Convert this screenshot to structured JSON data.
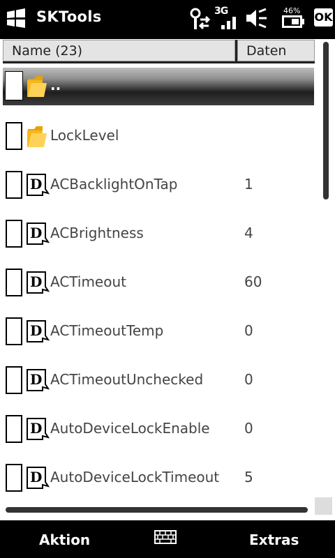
{
  "title_bar": {
    "app_title": "SKTools",
    "network_type": "3G",
    "battery_percent": "46%",
    "ok_label": "OK"
  },
  "list": {
    "columns": {
      "name": "Name (23)",
      "data": "Daten"
    },
    "rows": [
      {
        "name": "..",
        "value": "",
        "icon": "folder-icon",
        "selected": true
      },
      {
        "name": "LockLevel",
        "value": "",
        "icon": "folder-icon",
        "selected": false
      },
      {
        "name": "ACBacklightOnTap",
        "value": "1",
        "icon": "dword-value-icon",
        "selected": false
      },
      {
        "name": "ACBrightness",
        "value": "4",
        "icon": "dword-value-icon",
        "selected": false
      },
      {
        "name": "ACTimeout",
        "value": "60",
        "icon": "dword-value-icon",
        "selected": false
      },
      {
        "name": "ACTimeoutTemp",
        "value": "0",
        "icon": "dword-value-icon",
        "selected": false
      },
      {
        "name": "ACTimeoutUnchecked",
        "value": "0",
        "icon": "dword-value-icon",
        "selected": false
      },
      {
        "name": "AutoDeviceLockEnable",
        "value": "0",
        "icon": "dword-value-icon",
        "selected": false
      },
      {
        "name": "AutoDeviceLockTimeout",
        "value": "5",
        "icon": "dword-value-icon",
        "selected": false
      }
    ]
  },
  "soft_keys": {
    "left": "Aktion",
    "right": "Extras"
  },
  "colors": {
    "selection_dark": "#1e1e1e",
    "folder": "#f5b81c",
    "header_bg": "#e4e4e4"
  }
}
